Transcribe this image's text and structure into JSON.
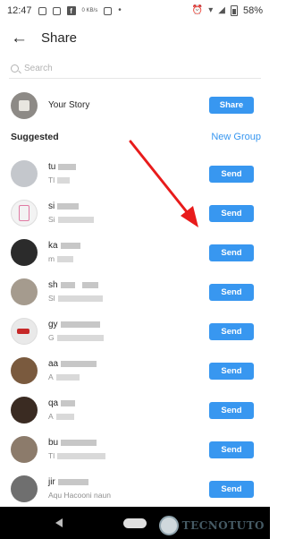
{
  "status_bar": {
    "time": "12:47",
    "network_speed": "0 KB/s",
    "battery": "58%"
  },
  "header": {
    "title": "Share",
    "back_icon": "arrow-left-icon"
  },
  "search": {
    "placeholder": "Search"
  },
  "your_story": {
    "label": "Your Story",
    "button_label": "Share"
  },
  "section": {
    "title": "Suggested",
    "new_group_label": "New Group"
  },
  "contacts": [
    {
      "name": "tu",
      "sub": "Tl",
      "button_label": "Send"
    },
    {
      "name": "si",
      "sub": "Si",
      "button_label": "Send"
    },
    {
      "name": "ka",
      "sub": "m",
      "button_label": "Send"
    },
    {
      "name": "sh",
      "sub": "Sl",
      "button_label": "Send"
    },
    {
      "name": "gy",
      "sub": "G",
      "button_label": "Send"
    },
    {
      "name": "aa",
      "sub": "A",
      "button_label": "Send"
    },
    {
      "name": "qa",
      "sub": "A",
      "button_label": "Send"
    },
    {
      "name": "bu",
      "sub": "Tl",
      "button_label": "Send"
    },
    {
      "name": "jir",
      "sub": "Aqu Hacooni naun",
      "button_label": "Send"
    }
  ],
  "watermark": {
    "text": "TECNOTUTO"
  },
  "colors": {
    "accent": "#3897f0",
    "annotation_arrow": "#e81b1b",
    "nav_bar": "#000000"
  }
}
